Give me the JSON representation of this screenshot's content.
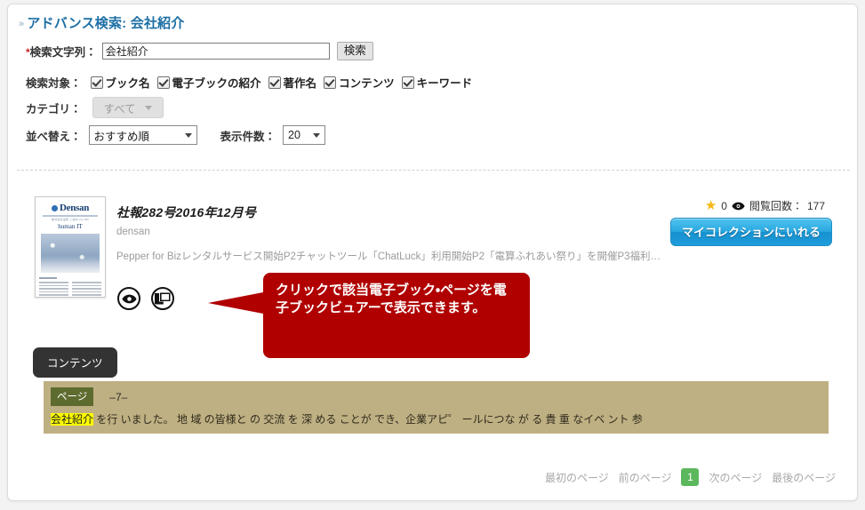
{
  "header": {
    "caret": "»",
    "title": "アドバンス検索: 会社紹介"
  },
  "form": {
    "keyword": {
      "star": "*",
      "label": "検索文字列：",
      "value": "会社紹介",
      "placeholder": "",
      "search_button": "検索"
    },
    "targets": {
      "label": "検索対象：",
      "items": [
        {
          "label": "ブック名",
          "checked": true
        },
        {
          "label": "電子ブックの紹介",
          "checked": true
        },
        {
          "label": "著作名",
          "checked": true
        },
        {
          "label": "コンテンツ",
          "checked": true
        },
        {
          "label": "キーワード",
          "checked": true
        }
      ]
    },
    "category": {
      "label": "カテゴリ：",
      "value": "すべて"
    },
    "sort": {
      "label": "並べ替え：",
      "value": "おすすめ順"
    },
    "count": {
      "label": "表示件数：",
      "value": "20"
    }
  },
  "result": {
    "thumbnail": {
      "logo_text": "Densan",
      "logo_sub": "株式会社電算 ご案内 vol.282",
      "tag": "human  IT"
    },
    "title": "社報282号2016年12月号",
    "author": "densan",
    "description": "Pepper for Bizレンタルサービス開始P2チャットツール「ChatLuck」利用開始P2「電算ふれあい祭り」を開催P3福利厚…",
    "actions": [
      {
        "name": "preview-icon",
        "glyph": "eye"
      },
      {
        "name": "viewer-icon",
        "glyph": "window"
      }
    ],
    "rating": "0",
    "views_label": "閲覧回数：",
    "views_value": "177",
    "collection_button": "マイコレクションにいれる"
  },
  "callout": {
    "text": "クリックで該当電子ブック・ページを電子ブックビュアーで表示できます。",
    "color": "#b00000"
  },
  "contents": {
    "tab_label": "コンテンツ",
    "page_badge": "ページ",
    "page_number": "–7–",
    "highlight": "会社紹介",
    "snippet": " を行 いました。 地 域 の皆様と の 交流 を 深 める ことが でき、企業アピ゜ ールにつな が る 貴 重 なイベ ント 参"
  },
  "pager": {
    "first": "最初のページ",
    "prev": "前のページ",
    "current": "1",
    "next": "次のページ",
    "last": "最後のページ",
    "accent": "#5cb85c"
  }
}
